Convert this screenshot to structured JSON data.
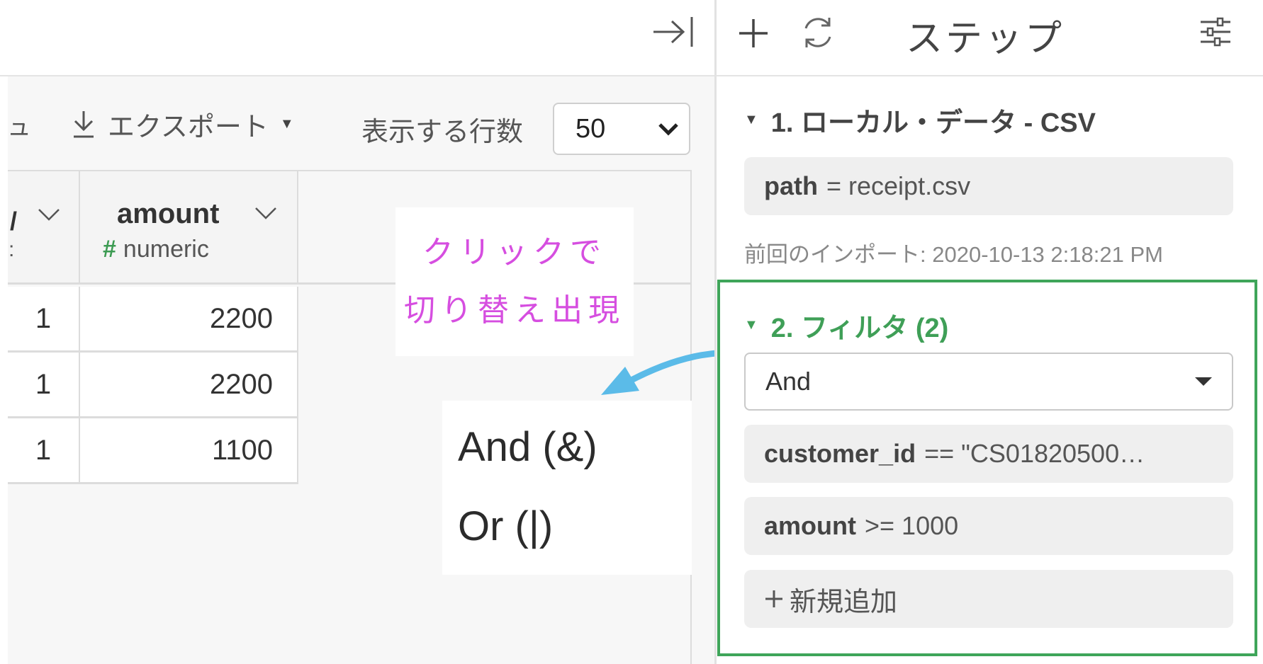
{
  "toolbar": {
    "left_fragment": "ュ",
    "export_label": "エクスポート",
    "rows_label": "表示する行数",
    "rows_value": "50"
  },
  "grid": {
    "prev_column_fragment": "/",
    "prev_column_type_fragment": ":",
    "columns": [
      {
        "name": "amount",
        "type_symbol": "#",
        "type": "numeric"
      }
    ],
    "rows": [
      {
        "prev": "1",
        "amount": "2200"
      },
      {
        "prev": "1",
        "amount": "2200"
      },
      {
        "prev": "1",
        "amount": "1100"
      }
    ]
  },
  "annotation": {
    "line1": "クリックで",
    "line2": "切り替え出現",
    "color": "#d64ee0",
    "arrow_color": "#5bbbe8"
  },
  "dropdown": {
    "options": [
      "And (&)",
      "Or (|)"
    ]
  },
  "panel": {
    "title": "ステップ",
    "steps": [
      {
        "label": "1. ローカル・データ - CSV",
        "param_key": "path",
        "param_op": "= receipt.csv",
        "last_import": "前回のインポート: 2020-10-13 2:18:21 PM"
      },
      {
        "label": "2. フィルタ (2)",
        "logic_value": "And",
        "conditions": [
          {
            "field": "customer_id",
            "expr": "== \"CS01820500…"
          },
          {
            "field": "amount",
            "expr": ">= 1000"
          }
        ],
        "add_label": "新規追加"
      }
    ],
    "accent": "#3fa55a"
  }
}
